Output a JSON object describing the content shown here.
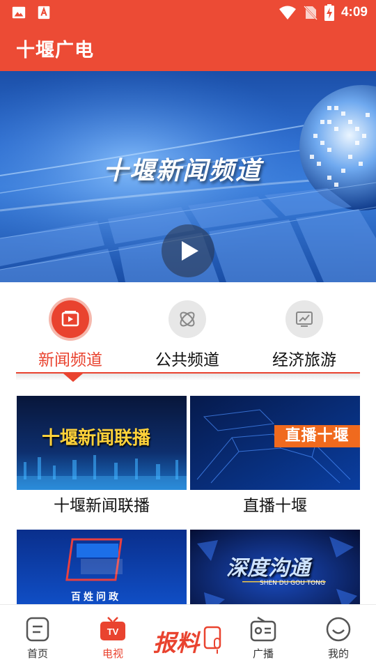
{
  "status_bar": {
    "time": "4:09",
    "left_icons": [
      "image-icon",
      "text-a-icon"
    ],
    "right_icons": [
      "wifi-icon",
      "no-sim-icon",
      "battery-charging-icon"
    ]
  },
  "header": {
    "title": "十堰广电"
  },
  "hero": {
    "title": "十堰新闻频道",
    "play_icon": "play-icon"
  },
  "channel_tabs": [
    {
      "label": "新闻频道",
      "icon": "tv-icon",
      "active": true
    },
    {
      "label": "公共频道",
      "icon": "atom-icon",
      "active": false
    },
    {
      "label": "经济旅游",
      "icon": "chart-icon",
      "active": false
    }
  ],
  "programs": [
    {
      "label": "十堰新闻联播",
      "thumb_text": "十堰新闻联播"
    },
    {
      "label": "直播十堰",
      "thumb_text": "直播十堰"
    },
    {
      "label": "",
      "thumb_text": "百姓问政",
      "thumb_logo": "百姓问政"
    },
    {
      "label": "",
      "thumb_text": "深度沟通",
      "thumb_sub": "SHEN DU GOU TONG"
    }
  ],
  "bottom_nav": {
    "items": [
      {
        "label": "首页",
        "icon": "home-icon",
        "active": false
      },
      {
        "label": "电视",
        "icon": "tv-icon",
        "active": true
      },
      {
        "label": "报料",
        "icon": "report-icon",
        "active": false
      },
      {
        "label": "广播",
        "icon": "radio-icon",
        "active": false
      },
      {
        "label": "我的",
        "icon": "profile-icon",
        "active": false
      }
    ]
  },
  "colors": {
    "brand": "#ec4b35",
    "active_tab": "#e9432f",
    "text": "#111111"
  }
}
